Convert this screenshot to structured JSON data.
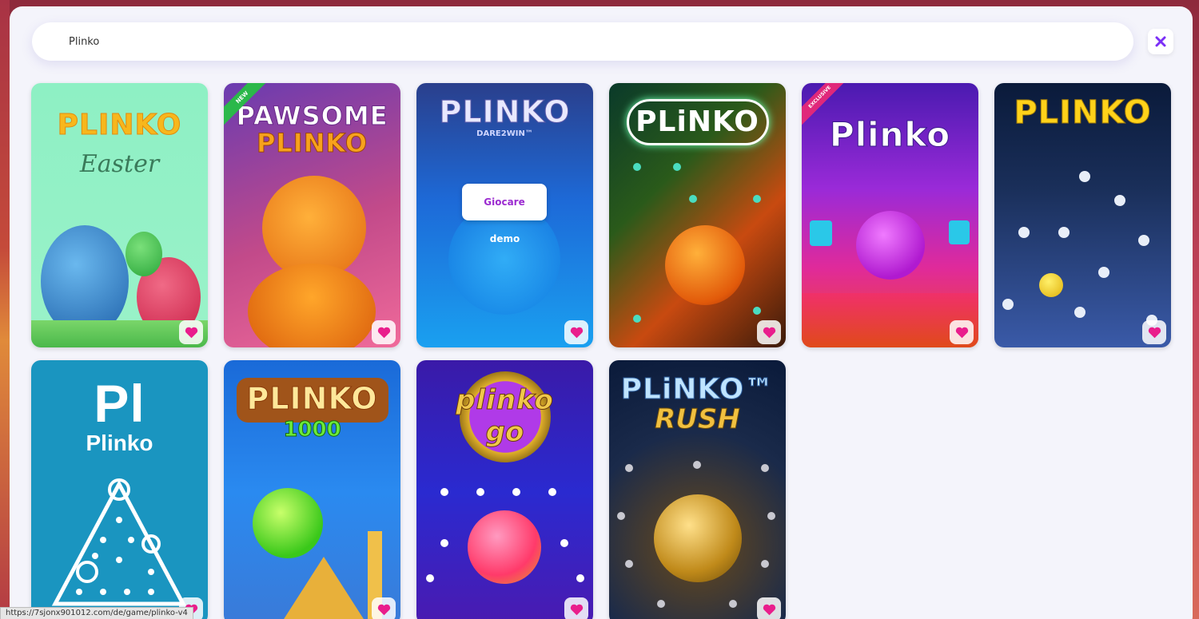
{
  "search": {
    "value": "Plinko",
    "placeholder": ""
  },
  "close_icon": "close-x-icon",
  "favorite_icon": "heart-icon",
  "accent": "#7b2ff7",
  "favorite_color": "#e91e8c",
  "cards": [
    {
      "name": "Plinko Easter",
      "title": "PLINKO",
      "subtitle": "Easter"
    },
    {
      "name": "Pawsome Plinko",
      "title": "PAWSOME",
      "title2": "PLINKO",
      "badge": "NEW"
    },
    {
      "name": "Plinko Dare2Win",
      "title": "PLINKO",
      "subtitle": "DARE2WIN™",
      "play_label": "Giocare",
      "demo_label": "demo"
    },
    {
      "name": "Plinko neon",
      "title": "PLiNKO"
    },
    {
      "name": "Plinko exclusive",
      "title": "Plinko",
      "badge": "EXCLUSIVE"
    },
    {
      "name": "Plinko yellow",
      "title": "PLINKO"
    },
    {
      "name": "Plinko Pl",
      "title": "Pl",
      "subtitle": "Plinko"
    },
    {
      "name": "Plinko 1000",
      "title": "PLINKO",
      "subtitle": "1000"
    },
    {
      "name": "Plinko Go",
      "title": "plinko",
      "subtitle": "go"
    },
    {
      "name": "Plinko Rush",
      "title": "PLiNKO™",
      "subtitle": "RUSH"
    }
  ],
  "status_url": "https://7sjonx901012.com/de/game/plinko-v4"
}
